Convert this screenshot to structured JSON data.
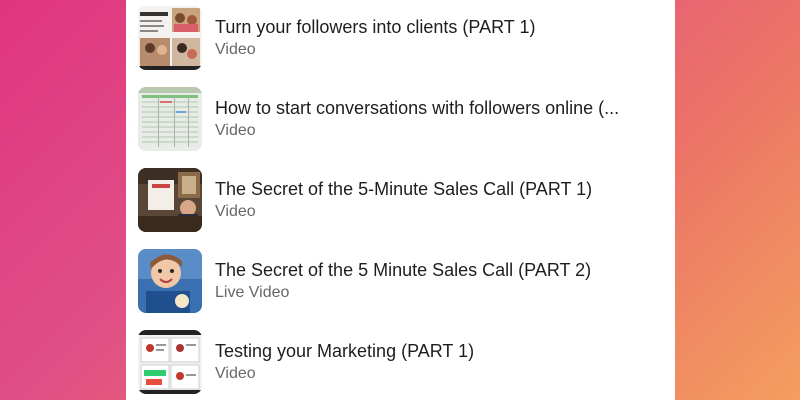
{
  "list": {
    "items": [
      {
        "title": "Turn your followers into clients (PART 1)",
        "type": "Video",
        "thumbnail": "webinar-grid-thumbnail"
      },
      {
        "title": "How to start conversations with followers online (...",
        "type": "Video",
        "thumbnail": "spreadsheet-thumbnail"
      },
      {
        "title": "The Secret of the 5-Minute Sales Call (PART 1)",
        "type": "Video",
        "thumbnail": "room-speaker-thumbnail"
      },
      {
        "title": "The Secret of the 5 Minute Sales Call (PART 2)",
        "type": "Live Video",
        "thumbnail": "presenter-face-thumbnail"
      },
      {
        "title": "Testing your Marketing (PART 1)",
        "type": "Video",
        "thumbnail": "slides-grid-thumbnail"
      }
    ]
  },
  "colors": {
    "background_start": "#e0357f",
    "background_end": "#f39f5f",
    "panel": "#ffffff",
    "title_text": "#1c1e21",
    "subtitle_text": "#65676b"
  }
}
